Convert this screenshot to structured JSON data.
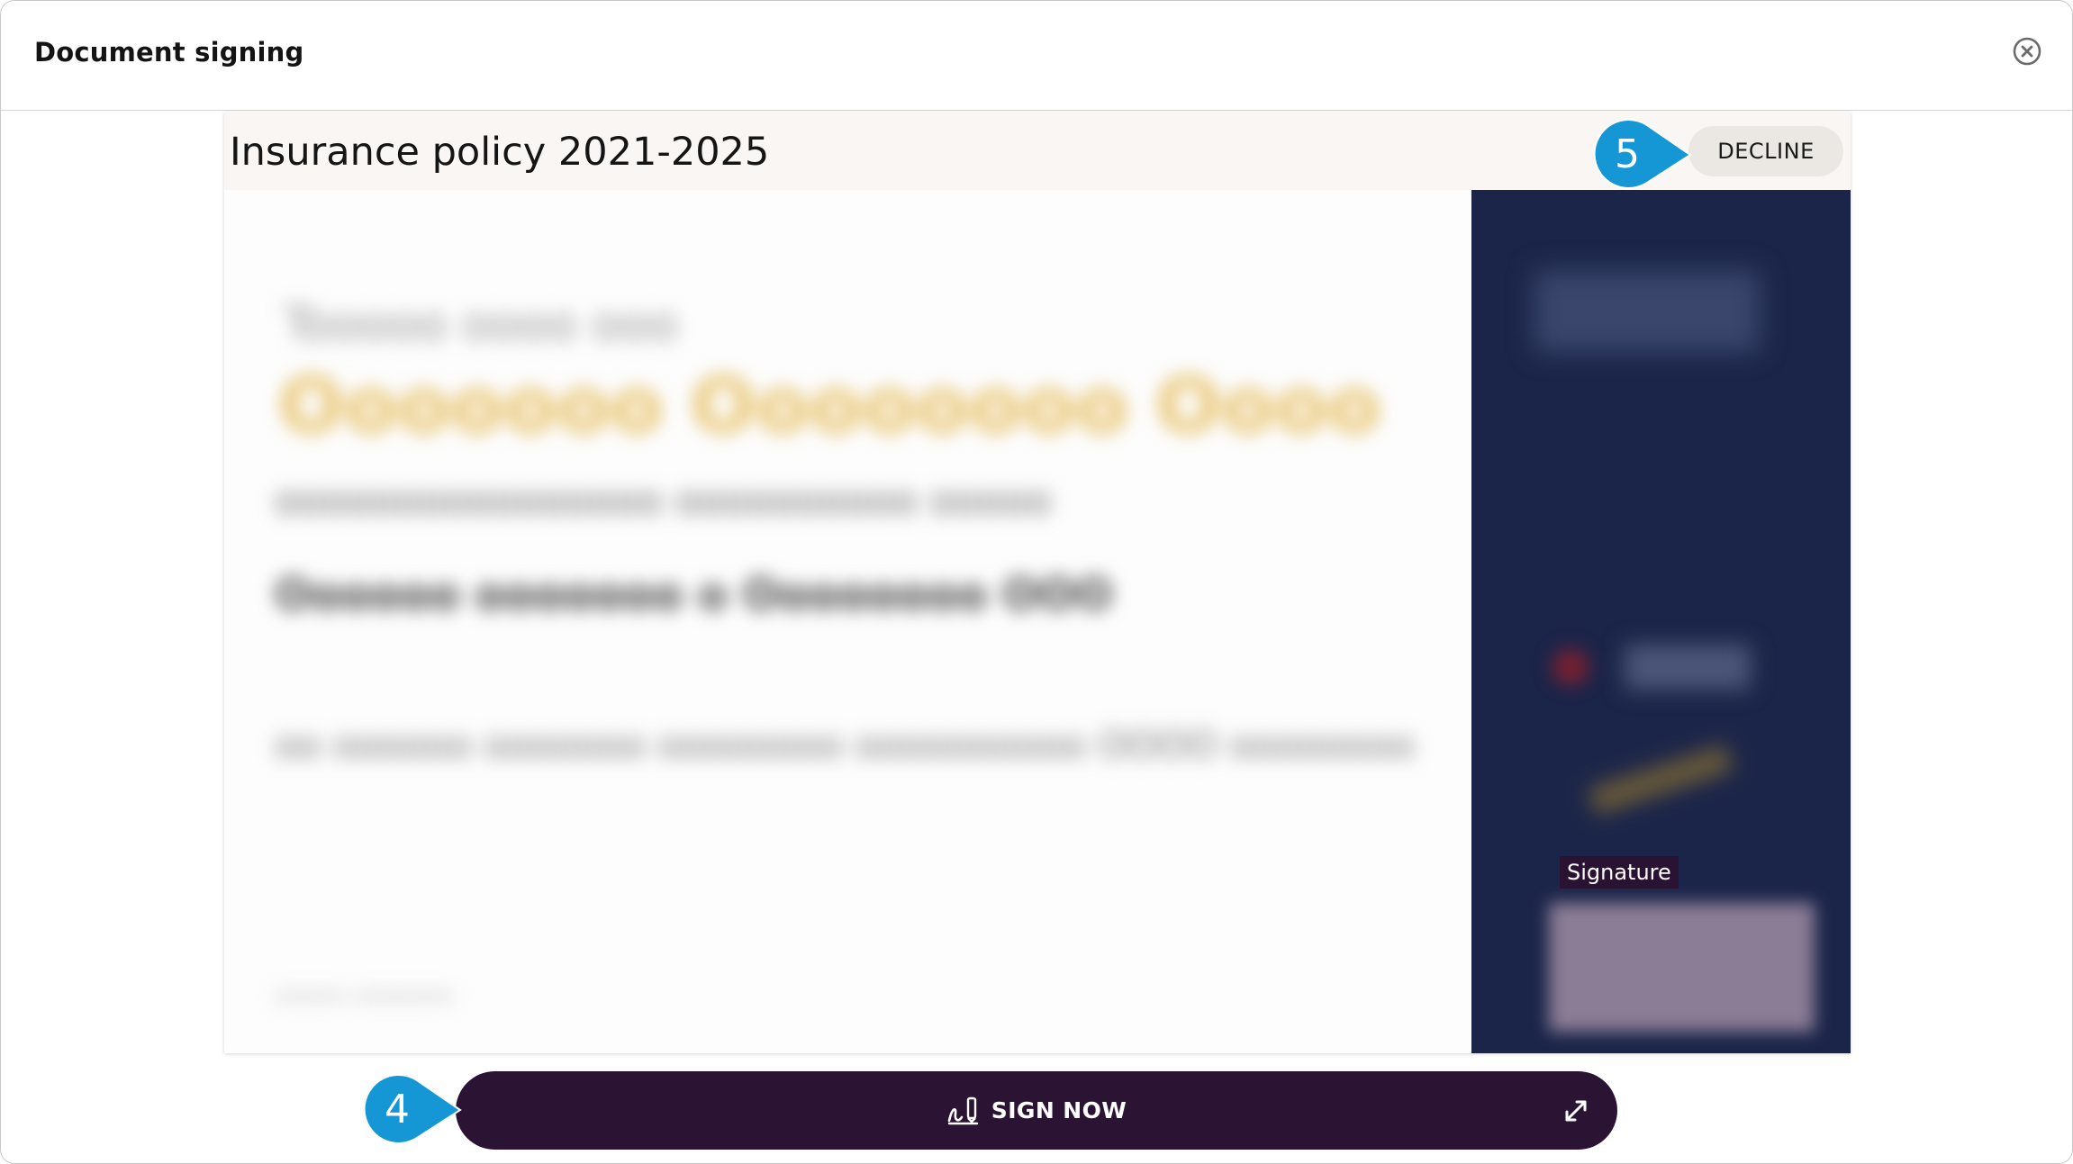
{
  "window": {
    "title": "Document signing"
  },
  "document": {
    "title": "Insurance policy 2021-2025",
    "decline_label": "DECLINE",
    "signature_label": "Signature"
  },
  "footer": {
    "sign_label": "SIGN NOW"
  },
  "callouts": [
    {
      "number": "5"
    },
    {
      "number": "4"
    }
  ],
  "colors": {
    "callout": "#1597d6",
    "sign_bar": "#2a1333",
    "side_panel": "#1b2549",
    "doc_header": "#f9f6f3"
  },
  "icons": {
    "close": "close-circle-icon",
    "sign": "signature-pen-icon",
    "expand": "expand-arrows-icon"
  }
}
